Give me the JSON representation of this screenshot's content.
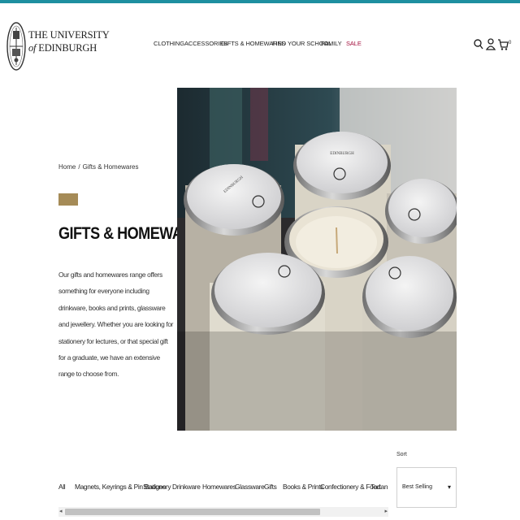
{
  "brand": {
    "line1": "THE UNIVERSITY",
    "line2_of": "of",
    "line2": "EDINBURGH"
  },
  "nav": [
    {
      "label": "CLOTHING"
    },
    {
      "label": "ACCESSORIES"
    },
    {
      "label": "GIFTS & HOMEWARES"
    },
    {
      "label": "FIND YOUR SCHOOL"
    },
    {
      "label": "FAMILY"
    },
    {
      "label": "SALE"
    }
  ],
  "header_icons": [
    "search-icon",
    "account-icon",
    "cart-icon"
  ],
  "cart": {
    "count": "0"
  },
  "breadcrumb": {
    "home": "Home",
    "separator": "/",
    "current": "Gifts & Homewares"
  },
  "page": {
    "title": "GIFTS & HOMEWARES",
    "intro": "Our gifts and homewares range offers something for everyone including drinkware, books and prints, glassware and jewellery. Whether you are looking for stationery for lectures, or that special gift for a graduate, we have an extensive range to choose from."
  },
  "sort": {
    "label": "Sort",
    "value": "Best Selling"
  },
  "filters": [
    {
      "label": "All"
    },
    {
      "label": "Magnets, Keyrings & Pin Badges"
    },
    {
      "label": "Stationery"
    },
    {
      "label": "Drinkware"
    },
    {
      "label": "Homewares"
    },
    {
      "label": "Glassware"
    },
    {
      "label": "Gifts"
    },
    {
      "label": "Books & Prints"
    },
    {
      "label": "Confectionery & Food"
    },
    {
      "label": "Tartan & T"
    }
  ],
  "scroll": {
    "left_arrow": "◂",
    "right_arrow": "▸"
  },
  "hero_candle_labels": [
    "EDINBURGH",
    "EDINBURGH"
  ],
  "colors": {
    "topbar": "#1e8fa0",
    "accent": "#a58b57",
    "sale": "#a4123f"
  }
}
